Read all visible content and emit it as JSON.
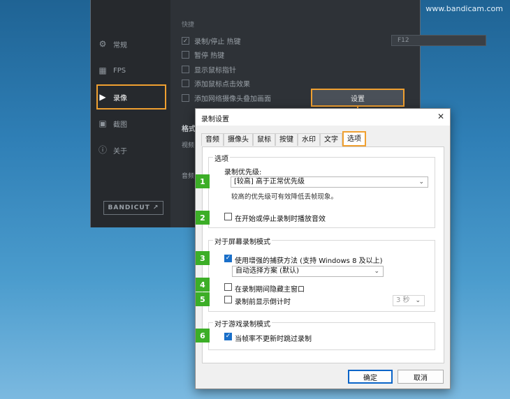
{
  "watermark": "www.bandicam.com",
  "sidebar": {
    "items": [
      {
        "label": "常规",
        "icon": "gear-icon"
      },
      {
        "label": "FPS",
        "icon": "fps-icon"
      },
      {
        "label": "录像",
        "icon": "video-icon"
      },
      {
        "label": "截图",
        "icon": "image-icon"
      },
      {
        "label": "关于",
        "icon": "info-icon"
      }
    ],
    "logo": "BANDICUT"
  },
  "content": {
    "section_hotkey": "快捷",
    "options": [
      {
        "label": "录制/停止 热键",
        "checked": true
      },
      {
        "label": "暂停 热键",
        "checked": false
      },
      {
        "label": "显示鼠标指针",
        "checked": false
      },
      {
        "label": "添加鼠标点击效果",
        "checked": false
      },
      {
        "label": "添加网络摄像头叠加画面",
        "checked": false
      }
    ],
    "hotkey_value": "F12",
    "settings_button": "设置",
    "format_label": "格式",
    "video_label": "视频",
    "audio_label": "音频"
  },
  "dialog": {
    "title": "录制设置",
    "tabs": [
      "音频",
      "摄像头",
      "鼠标",
      "按键",
      "水印",
      "文字",
      "选项"
    ],
    "active_tab": "选项",
    "group_options": {
      "title": "选项",
      "priority_label": "录制优先级:",
      "priority_value": "[较高] 高于正常优先级",
      "priority_note": "较高的优先级可有效降低丢帧现象。",
      "play_sound_label": "在开始或停止录制时播放音效",
      "play_sound_checked": false
    },
    "group_screen": {
      "title": "对于屏幕录制模式",
      "enhanced_label": "使用增强的捕获方法 (支持 Windows 8 及以上)",
      "enhanced_checked": true,
      "method_value": "自动选择方案 (默认)",
      "hide_window_label": "在录制期间隐藏主窗口",
      "hide_window_checked": false,
      "countdown_label": "录制前显示倒计时",
      "countdown_checked": false,
      "countdown_value": "3 秒"
    },
    "group_game": {
      "title": "对于游戏录制模式",
      "skip_label": "当帧率不更新时跳过录制",
      "skip_checked": true
    },
    "ok_label": "确定",
    "cancel_label": "取消"
  },
  "badges": [
    "1",
    "2",
    "3",
    "4",
    "5",
    "6"
  ],
  "colors": {
    "accent": "#f0a030",
    "badge": "#3cae27",
    "checkbox": "#1a6fc9"
  }
}
